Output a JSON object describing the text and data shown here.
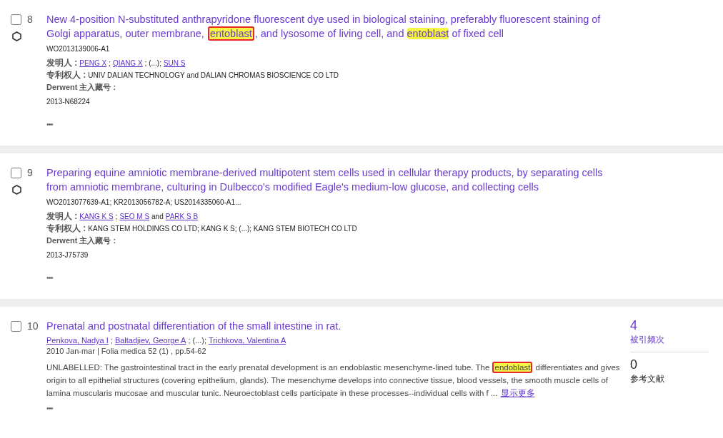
{
  "records": [
    {
      "kind": "patent",
      "number": "8",
      "checked": false,
      "title": [
        {
          "text": "New 4-position N-substituted anthrapyridone fluorescent dye used in biological staining, preferably fluorescent staining of Golgi apparatus, outer membrane, ",
          "highlight": false,
          "boxed": false
        },
        {
          "text": "entoblast",
          "highlight": true,
          "boxed": true
        },
        {
          "text": ", and lysosome of living cell, and ",
          "highlight": false,
          "boxed": false
        },
        {
          "text": "entoblast",
          "highlight": true,
          "boxed": false
        },
        {
          "text": " of fixed cell",
          "highlight": false,
          "boxed": false
        }
      ],
      "patent_numbers": "WO2013139006-A1",
      "inventors": {
        "label": "发明人 :",
        "parts": [
          {
            "text": "PENG X",
            "link": true
          },
          {
            "text": ";",
            "link": false
          },
          {
            "text": "QIANG X",
            "link": true
          },
          {
            "text": "; (...);",
            "link": false
          },
          {
            "text": "SUN S",
            "link": true
          }
        ]
      },
      "assignees": {
        "label": "专利权人 :",
        "value": "UNIV DALIAN TECHNOLOGY and DALIAN CHROMAS BIOSCIENCE CO LTD"
      },
      "derwent": {
        "label": "Derwent 主入藏号 :",
        "value": "2013-N68224"
      },
      "more": "•••"
    },
    {
      "kind": "patent",
      "number": "9",
      "checked": false,
      "title": [
        {
          "text": "Preparing equine amniotic membrane-derived multipotent stem cells used in cellular therapy products, by separating cells from amniotic membrane, culturing in Dulbecco's modified Eagle's medium-low glucose, and collecting cells",
          "highlight": false,
          "boxed": false
        }
      ],
      "patent_numbers": "WO2013077639-A1; KR2013056782-A; US2014335060-A1...",
      "inventors": {
        "label": "发明人 :",
        "parts": [
          {
            "text": "KANG K S",
            "link": true
          },
          {
            "text": ";",
            "link": false
          },
          {
            "text": "SEO M S",
            "link": true
          },
          {
            "text": "and",
            "link": false
          },
          {
            "text": "PARK S B",
            "link": true
          }
        ]
      },
      "assignees": {
        "label": "专利权人 :",
        "value": "KANG STEM HOLDINGS CO LTD; KANG K S; (...); KANG STEM BIOTECH CO LTD"
      },
      "derwent": {
        "label": "Derwent 主入藏号 :",
        "value": "2013-J75739"
      },
      "more": "•••"
    },
    {
      "kind": "article",
      "number": "10",
      "checked": false,
      "title": [
        {
          "text": "Prenatal and postnatal differentiation of the small intestine in rat.",
          "highlight": false,
          "boxed": false
        }
      ],
      "authors": [
        {
          "text": "Penkova, Nadya I",
          "link": true
        },
        {
          "text": ";",
          "link": false
        },
        {
          "text": "Baltadjiev, George A",
          "link": true
        },
        {
          "text": "; (...);",
          "link": false
        },
        {
          "text": "Trichkova, Valentina A",
          "link": true
        }
      ],
      "source": "2010 Jan-mar | Folia medica 52 (1) , pp.54-62",
      "abstract": [
        {
          "text": "UNLABELLED: The gastrointestinal tract in the early prenatal development is an endoblastic mesenchyme-lined tube. The ",
          "highlight": false,
          "boxed": false
        },
        {
          "text": "endoblast",
          "highlight": true,
          "boxed": true
        },
        {
          "text": " differentiates and gives origin to all epithelial structures (covering epithelium, glands). The mesenchyme develops into connective tissue, blood vessels, the smooth muscle cells of lamina muscularis mucosae and muscular tunic. Neuroectoblast cells participate in these processes--individual cells with f ...",
          "highlight": false,
          "boxed": false
        }
      ],
      "show_more": "显示更多",
      "metrics": [
        {
          "value": "4",
          "label": "被引频次",
          "link": true
        },
        {
          "value": "0",
          "label": "参考文献",
          "link": false
        }
      ],
      "more": "•••"
    }
  ]
}
